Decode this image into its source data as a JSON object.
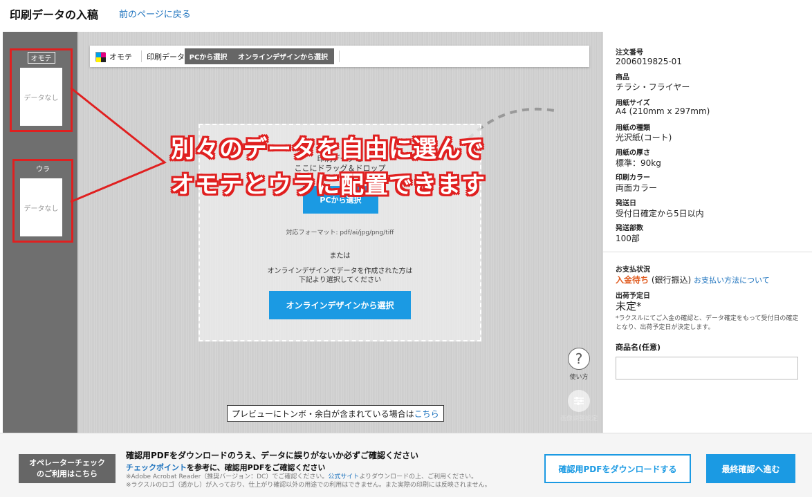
{
  "header": {
    "title": "印刷データの入稿",
    "back_link": "前のページに戻る"
  },
  "thumbnails": {
    "front": {
      "label": "オモテ",
      "placeholder": "データなし"
    },
    "back": {
      "label": "ウラ",
      "placeholder": "データなし"
    }
  },
  "toolbar": {
    "side_label": "オモテ",
    "data_label": "印刷データ",
    "pc_button": "PCから選択",
    "online_button": "オンラインデザインから選択"
  },
  "dropzone": {
    "heading_line1": "印刷データを",
    "heading_line2": "ここにドラッグ＆ドロップ",
    "pc_button": "PCから選択",
    "formats": "対応フォーマット: pdf/ai/jpg/png/tiff",
    "or": "または",
    "online_note_line1": "オンラインデザインでデータを作成された方は",
    "online_note_line2": "下記より選択してください",
    "online_button": "オンラインデザインから選択"
  },
  "help": {
    "label": "使い方",
    "adjust_label": "画像調整設定"
  },
  "preview_note": {
    "text": "プレビューにトンボ・余白が含まれている場合は",
    "link": "こちら"
  },
  "annotation": {
    "line1": "別々のデータを自由に選んで",
    "line2": "オモテとウラに配置できます"
  },
  "order": {
    "fields": [
      {
        "label": "注文番号",
        "value": "2006019825-01"
      },
      {
        "label": "商品",
        "value": "チラシ・フライヤー"
      },
      {
        "label": "用紙サイズ",
        "value": "A4 (210mm x 297mm)"
      },
      {
        "label": "用紙の種類",
        "value": "光沢紙(コート)"
      },
      {
        "label": "用紙の厚さ",
        "value": "標準：90kg"
      },
      {
        "label": "印刷カラー",
        "value": "両面カラー"
      },
      {
        "label": "発送日",
        "value": "受付日確定から5日以内"
      },
      {
        "label": "発送部数",
        "value": "100部"
      }
    ],
    "payment": {
      "label": "お支払状況",
      "status": "入金待ち",
      "method": "(銀行振込)",
      "link": "お支払い方法について"
    },
    "ship": {
      "label": "出荷予定日",
      "value": "未定*",
      "note": "*ラクスルにてご入金の確認と、データ確定をもって受付日の確定となり、出荷予定日が決定します。"
    },
    "product_name": {
      "label": "商品名(任意)",
      "value": ""
    }
  },
  "bottom": {
    "operator_button": "オペレーターチェックのご利用はこちら",
    "title": "確認用PDFをダウンロードのうえ、データに誤りがないか必ずご確認ください",
    "sub_link": "チェックポイント",
    "sub_text": "を参考に、確認用PDFをご確認ください",
    "note1_pre": "※Adobe Acrobat Reader（推奨バージョン：DC）でご確認ください。",
    "note1_link": "公式サイト",
    "note1_post": "よりダウンロードの上、ご利用ください。",
    "note2": "※ラクスルのロゴ（透かし）が入っており、仕上がり確認以外の用途での利用はできません。また実際の印刷には反映されません。",
    "download_button": "確認用PDFをダウンロードする",
    "final_button": "最終確認へ進む"
  },
  "colors": {
    "accent": "#1b9ae3",
    "annotation_red": "#e02020",
    "status_orange": "#e05a1e"
  }
}
